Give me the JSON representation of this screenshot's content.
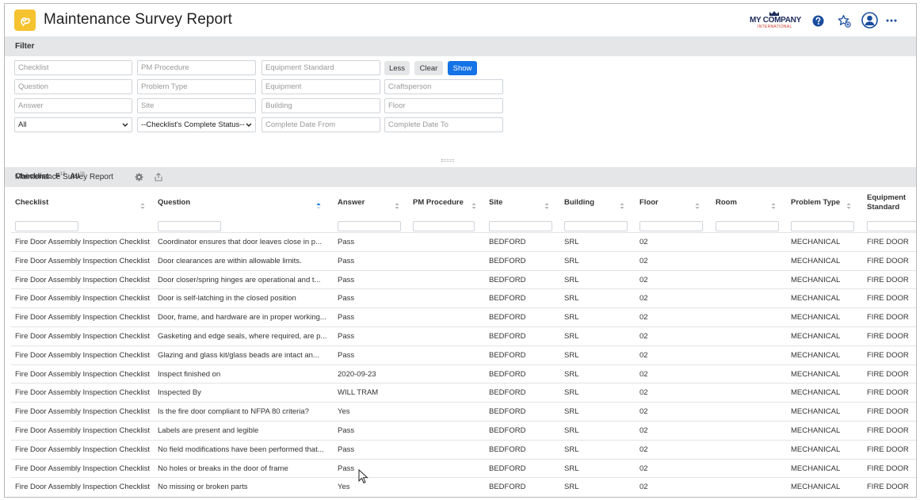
{
  "header": {
    "title": "Maintenance Survey Report",
    "company_name": "MY COMPANY",
    "company_sub": "INTERNATIONAL",
    "icons": [
      "help-icon",
      "favorites-icon",
      "user-icon",
      "more-icon"
    ],
    "accent": "#f5c330"
  },
  "filter": {
    "label": "Filter",
    "placeholders": {
      "checklist": "Checklist",
      "pm_procedure": "PM Procedure",
      "equipment_standard": "Equipment Standard",
      "question": "Question",
      "problem_type": "Problem Type",
      "equipment": "Equipment",
      "craftsperson": "Craftsperson",
      "answer": "Answer",
      "site": "Site",
      "building": "Building",
      "floor": "Floor",
      "complete_date_from": "Complete Date From",
      "complete_date_to": "Complete Date To"
    },
    "select_all": "All",
    "select_status": "--Checklist's Complete Status--",
    "buttons": {
      "less": "Less",
      "clear": "Clear",
      "show": "Show"
    },
    "show_color": "#1473e6"
  },
  "report": {
    "title": "Maintenance Survey Report",
    "checklist_label": "Checklist:",
    "checklist_f": "F",
    "checklist_f_count": "16",
    "checklist_all": "All",
    "checklist_all_count": "16",
    "columns": [
      "Checklist",
      "Question",
      "Answer",
      "PM Procedure",
      "Site",
      "Building",
      "Floor",
      "Room",
      "Problem Type",
      "Equipment Standard"
    ],
    "rows": [
      [
        "Fire Door Assembly Inspection Checklist",
        "Coordinator ensures that door leaves close in p...",
        "Pass",
        "",
        "BEDFORD",
        "SRL",
        "02",
        "",
        "MECHANICAL",
        "FIRE DOOR"
      ],
      [
        "Fire Door Assembly Inspection Checklist",
        "Door clearances are within allowable limits.",
        "Pass",
        "",
        "BEDFORD",
        "SRL",
        "02",
        "",
        "MECHANICAL",
        "FIRE DOOR"
      ],
      [
        "Fire Door Assembly Inspection Checklist",
        "Door closer/spring hinges are operational and t...",
        "Pass",
        "",
        "BEDFORD",
        "SRL",
        "02",
        "",
        "MECHANICAL",
        "FIRE DOOR"
      ],
      [
        "Fire Door Assembly Inspection Checklist",
        "Door is self-latching in the closed position",
        "Pass",
        "",
        "BEDFORD",
        "SRL",
        "02",
        "",
        "MECHANICAL",
        "FIRE DOOR"
      ],
      [
        "Fire Door Assembly Inspection Checklist",
        "Door, frame, and hardware are in proper working...",
        "Pass",
        "",
        "BEDFORD",
        "SRL",
        "02",
        "",
        "MECHANICAL",
        "FIRE DOOR"
      ],
      [
        "Fire Door Assembly Inspection Checklist",
        "Gasketing and edge seals, where required, are p...",
        "Pass",
        "",
        "BEDFORD",
        "SRL",
        "02",
        "",
        "MECHANICAL",
        "FIRE DOOR"
      ],
      [
        "Fire Door Assembly Inspection Checklist",
        "Glazing and glass kit/glass beads are intact an...",
        "Pass",
        "",
        "BEDFORD",
        "SRL",
        "02",
        "",
        "MECHANICAL",
        "FIRE DOOR"
      ],
      [
        "Fire Door Assembly Inspection Checklist",
        "Inspect finished on",
        "2020-09-23",
        "",
        "BEDFORD",
        "SRL",
        "02",
        "",
        "MECHANICAL",
        "FIRE DOOR"
      ],
      [
        "Fire Door Assembly Inspection Checklist",
        "Inspected By",
        "WILL TRAM",
        "",
        "BEDFORD",
        "SRL",
        "02",
        "",
        "MECHANICAL",
        "FIRE DOOR"
      ],
      [
        "Fire Door Assembly Inspection Checklist",
        "Is the fire door compliant to NFPA 80 criteria?",
        "Yes",
        "",
        "BEDFORD",
        "SRL",
        "02",
        "",
        "MECHANICAL",
        "FIRE DOOR"
      ],
      [
        "Fire Door Assembly Inspection Checklist",
        "Labels are present and legible",
        "Pass",
        "",
        "BEDFORD",
        "SRL",
        "02",
        "",
        "MECHANICAL",
        "FIRE DOOR"
      ],
      [
        "Fire Door Assembly Inspection Checklist",
        "No field modifications have been performed that...",
        "Pass",
        "",
        "BEDFORD",
        "SRL",
        "02",
        "",
        "MECHANICAL",
        "FIRE DOOR"
      ],
      [
        "Fire Door Assembly Inspection Checklist",
        "No holes or breaks in the door of frame",
        "Pass",
        "",
        "BEDFORD",
        "SRL",
        "02",
        "",
        "MECHANICAL",
        "FIRE DOOR"
      ],
      [
        "Fire Door Assembly Inspection Checklist",
        "No missing or broken parts",
        "Yes",
        "",
        "BEDFORD",
        "SRL",
        "02",
        "",
        "MECHANICAL",
        "FIRE DOOR"
      ]
    ]
  }
}
